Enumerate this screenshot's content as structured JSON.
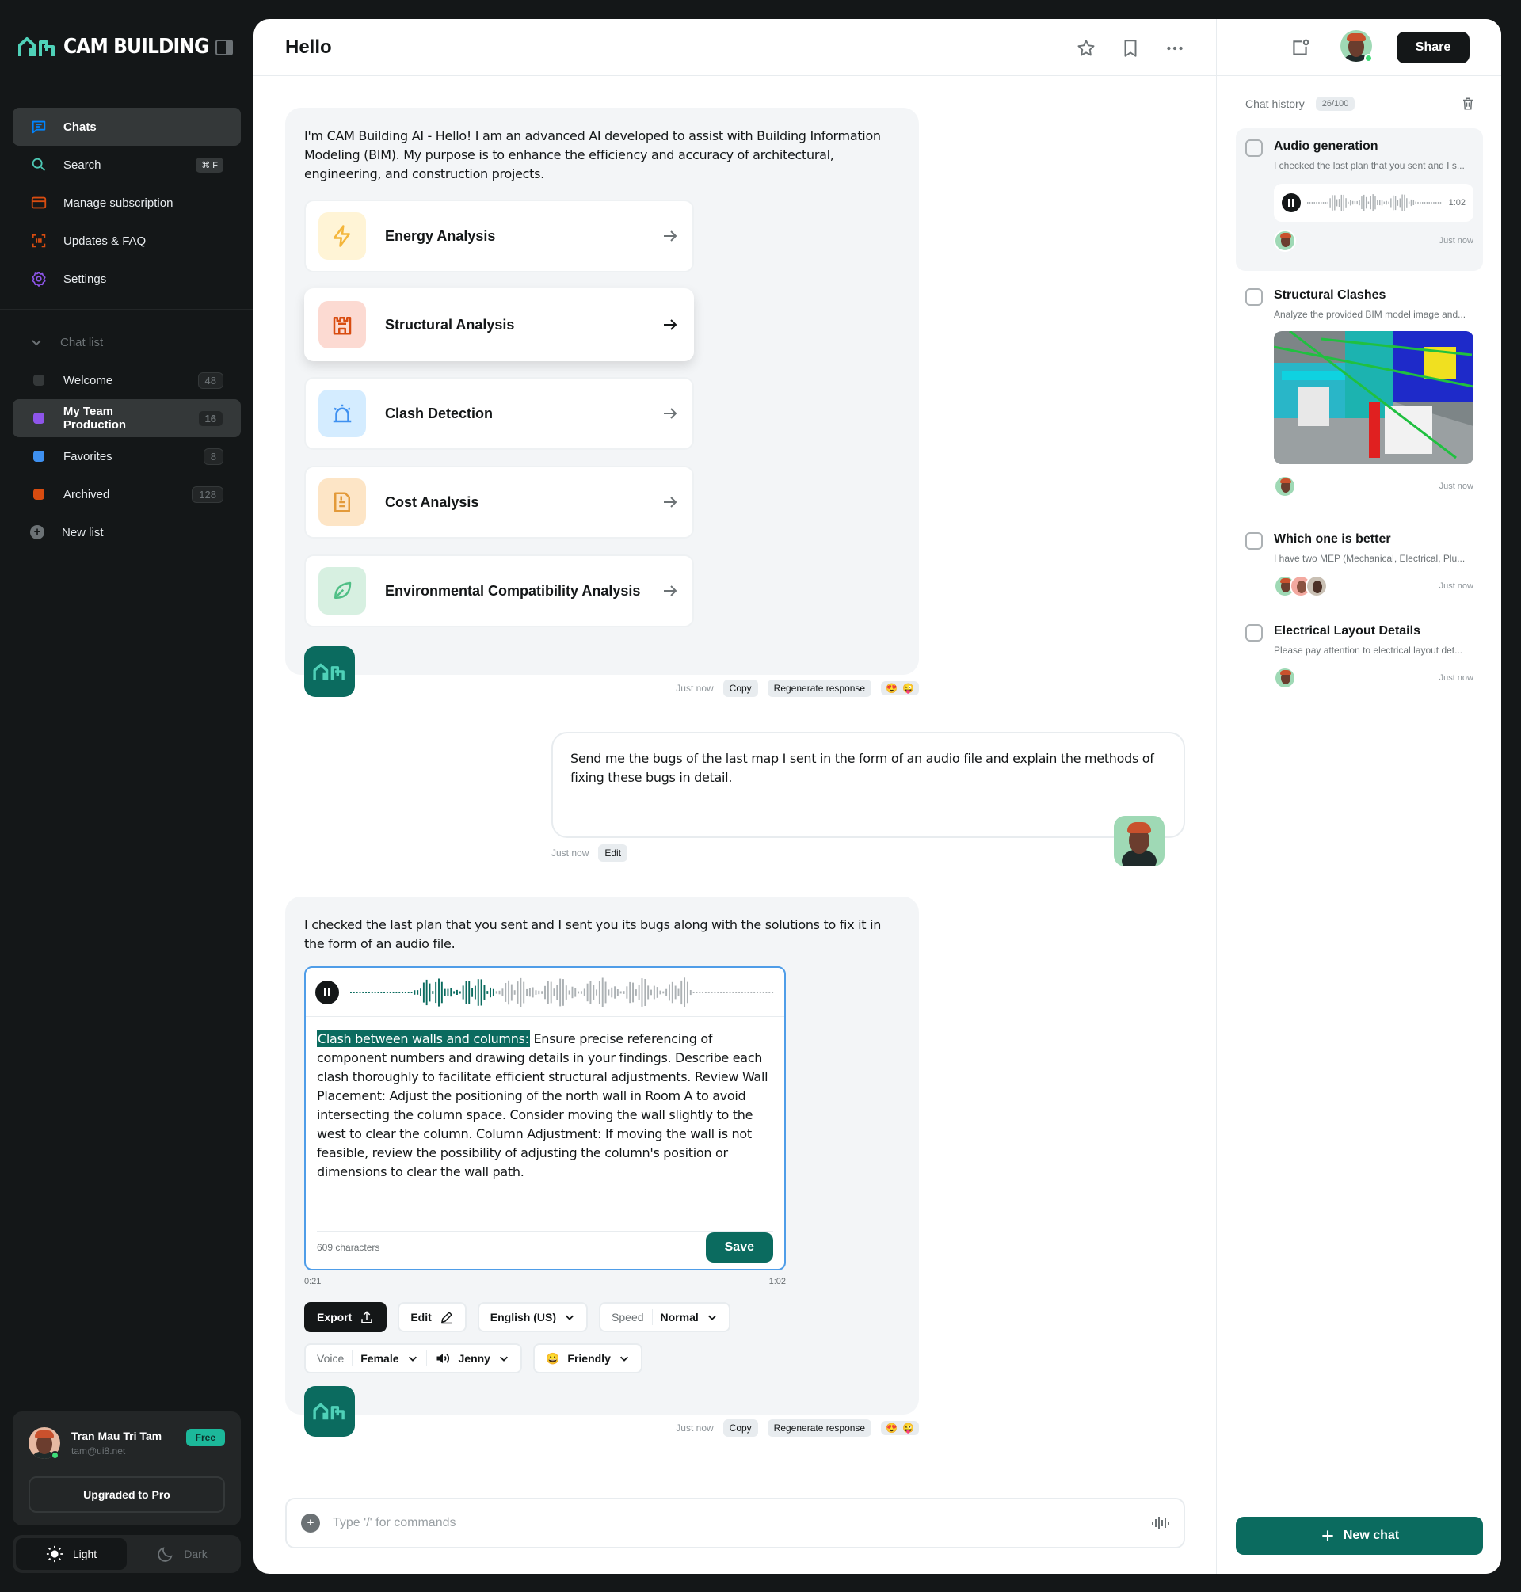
{
  "brand": {
    "name": "CAM BUILDING"
  },
  "nav": {
    "items": [
      {
        "label": "Chats",
        "icon": "chat-icon",
        "color": "#0084ff"
      },
      {
        "label": "Search",
        "icon": "search-icon",
        "shortcut": "⌘ F",
        "color": "#4dc8b4"
      },
      {
        "label": "Manage subscription",
        "icon": "card-icon",
        "color": "#d84c10"
      },
      {
        "label": "Updates & FAQ",
        "icon": "scan-icon",
        "color": "#d84c10"
      },
      {
        "label": "Settings",
        "icon": "gear-icon",
        "color": "#8e55ea"
      }
    ]
  },
  "chat_list": {
    "heading": "Chat list",
    "items": [
      {
        "label": "Welcome",
        "count": "48",
        "color": "#343839"
      },
      {
        "label": "My Team Production",
        "count": "16",
        "color": "#8e55ea"
      },
      {
        "label": "Favorites",
        "count": "8",
        "color": "#3e90f0"
      },
      {
        "label": "Archived",
        "count": "128",
        "color": "#d84c10"
      }
    ],
    "new_list": "New list"
  },
  "user": {
    "name": "Tran Mau Tri Tam",
    "email": "tam@ui8.net",
    "plan": "Free",
    "upgrade": "Upgraded to Pro"
  },
  "theme": {
    "light": "Light",
    "dark": "Dark"
  },
  "header": {
    "title": "Hello",
    "share": "Share"
  },
  "messages": {
    "intro": "I'm CAM Building AI - Hello! I am an advanced AI developed to assist with Building Information Modeling (BIM). My purpose is to enhance the efficiency and accuracy of architectural, engineering, and construction projects.",
    "cards": [
      {
        "label": "Energy Analysis",
        "icon": "bolt-icon",
        "bg": "#fff4d6",
        "fg": "#f4b63c"
      },
      {
        "label": "Structural Analysis",
        "icon": "castle-icon",
        "bg": "#fcdad2",
        "fg": "#d84c10"
      },
      {
        "label": "Clash Detection",
        "icon": "alarm-icon",
        "bg": "#d4ecff",
        "fg": "#3e90f0"
      },
      {
        "label": "Cost Analysis",
        "icon": "receipt-icon",
        "bg": "#fde5c6",
        "fg": "#e39a3a"
      },
      {
        "label": "Environmental Compatibility Analysis",
        "icon": "leaf-icon",
        "bg": "#d7f0e1",
        "fg": "#4fbf85"
      }
    ],
    "meta_time": "Just now",
    "copy": "Copy",
    "regenerate": "Regenerate response",
    "user_text": "Send me the bugs of the last map I sent in the form of an audio file and explain the methods of fixing these bugs in detail.",
    "edit": "Edit",
    "reply": "I checked the last plan that you sent and I sent you its bugs along with the solutions to fix it in the form of an audio file.",
    "audio_highlight": "Clash between walls and columns:",
    "audio_text": " Ensure precise referencing of component numbers and drawing details in your findings. Describe each clash thoroughly to facilitate efficient structural adjustments. Review Wall Placement: Adjust the positioning of the north wall in Room A to avoid intersecting the column space. Consider moving the wall slightly to the west to clear the column. Column Adjustment: If moving the wall is not feasible, review the possibility of adjusting the column's position or dimensions to clear the wall path.",
    "char_count": "609 characters",
    "save": "Save",
    "time_start": "0:21",
    "time_end": "1:02",
    "progress": 0.34,
    "controls": {
      "export": "Export",
      "edit": "Edit",
      "language": "English (US)",
      "speed_label": "Speed",
      "speed": "Normal",
      "voice_label": "Voice",
      "voice": "Female",
      "voice_name": "Jenny",
      "tone": "Friendly"
    }
  },
  "composer": {
    "placeholder": "Type '/' for commands"
  },
  "history": {
    "title": "Chat history",
    "count": "26/100",
    "items": [
      {
        "title": "Audio generation",
        "sub": "I checked the last plan that you sent and I s...",
        "time": "Just now",
        "audio_time": "1:02"
      },
      {
        "title": "Structural Clashes",
        "sub": "Analyze the provided BIM model image and...",
        "time": "Just now"
      },
      {
        "title": "Which one is better",
        "sub": "I have two MEP (Mechanical, Electrical, Plu...",
        "time": "Just now"
      },
      {
        "title": "Electrical Layout Details",
        "sub": "Please pay attention to electrical layout det...",
        "time": "Just now"
      }
    ],
    "new_chat": "New chat"
  }
}
